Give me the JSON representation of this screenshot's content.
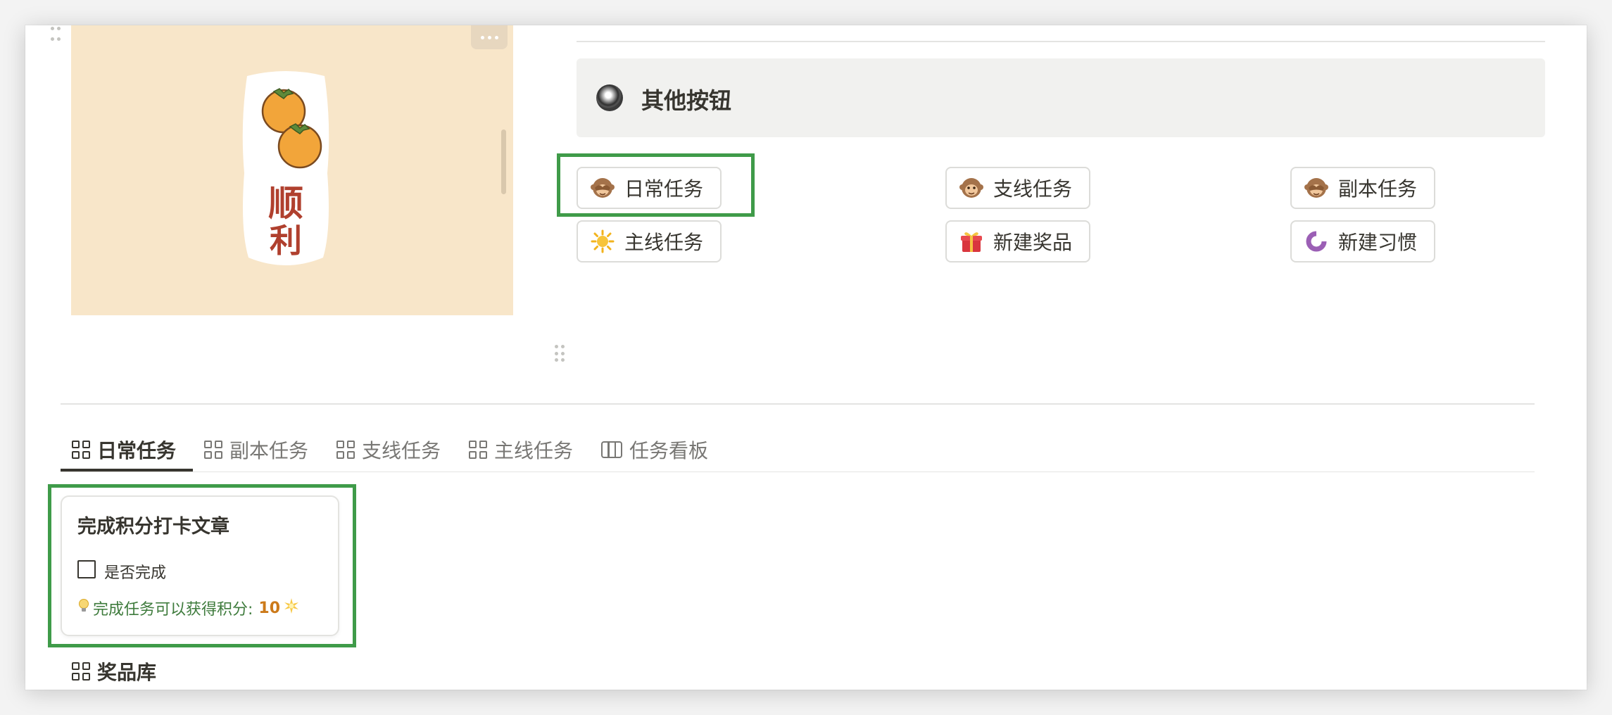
{
  "callout": {
    "title": "其他按钮",
    "icon": "radio-button-icon"
  },
  "buttons": [
    {
      "emoji": "see-no-evil-monkey-icon",
      "label": "日常任务"
    },
    {
      "emoji": "monkey-face-icon",
      "label": "支线任务"
    },
    {
      "emoji": "see-no-evil-monkey-icon",
      "label": "副本任务"
    },
    {
      "emoji": "sun-icon",
      "label": "主线任务"
    },
    {
      "emoji": "gift-icon",
      "label": "新建奖品"
    },
    {
      "emoji": "habit-ring-icon",
      "label": "新建习惯"
    }
  ],
  "cover": {
    "charm_text": "顺利",
    "more_icon": "more-horizontal-icon"
  },
  "tabs": [
    {
      "label": "日常任务",
      "icon": "gallery-icon",
      "active": true
    },
    {
      "label": "副本任务",
      "icon": "gallery-icon",
      "active": false
    },
    {
      "label": "支线任务",
      "icon": "gallery-icon",
      "active": false
    },
    {
      "label": "主线任务",
      "icon": "gallery-icon",
      "active": false
    },
    {
      "label": "任务看板",
      "icon": "board-icon",
      "active": false
    }
  ],
  "card": {
    "title": "完成积分打卡文章",
    "checkbox_label": "是否完成",
    "checked": false,
    "points_text": "完成任务可以获得积分:",
    "points_value": "10"
  },
  "prize_section": {
    "label": "奖品库"
  },
  "colors": {
    "highlight": "#3f9b49",
    "points_text": "#3e7b3c",
    "points_value": "#cc7a1a",
    "callout_bg": "#f1f1ef",
    "cover_bg": "#f8e6c9"
  }
}
